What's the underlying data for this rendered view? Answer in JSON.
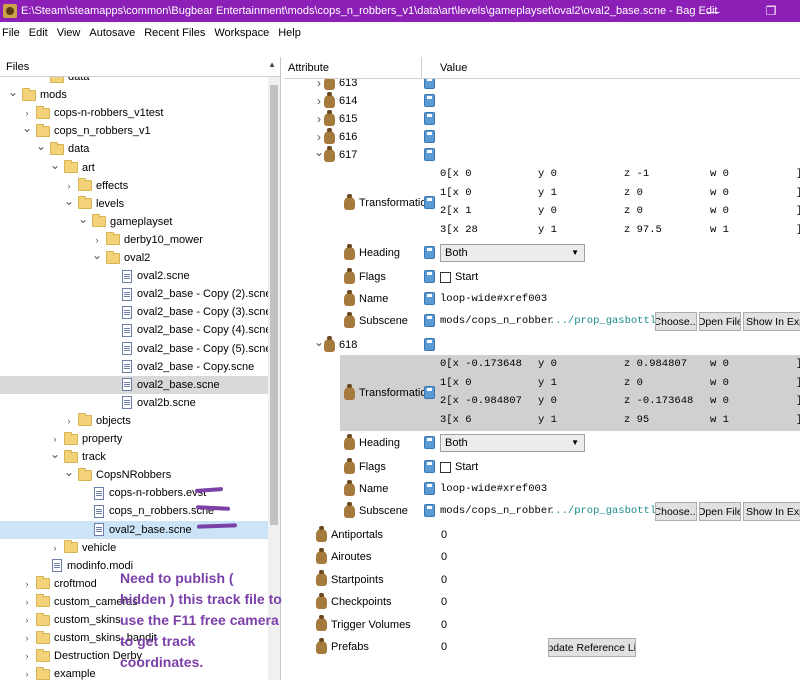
{
  "window": {
    "title": "E:\\Steam\\steamapps\\common\\Bugbear Entertainment\\mods\\cops_n_robbers_v1\\data\\art\\levels\\gameplayset\\oval2\\oval2_base.scne - Bag Edit",
    "minimize": "—",
    "maximize": "❐"
  },
  "menu": [
    "File",
    "Edit",
    "View",
    "Autosave",
    "Recent Files",
    "Workspace",
    "Help"
  ],
  "files_panel": {
    "header": "Files",
    "tree": [
      {
        "label": "data",
        "level": 2,
        "type": "folder",
        "arrow": "",
        "partial": true
      },
      {
        "label": "mods",
        "level": 0,
        "type": "folder",
        "arrow": "⌄"
      },
      {
        "label": "cops-n-robbers_v1test",
        "level": 1,
        "type": "folder",
        "arrow": "›"
      },
      {
        "label": "cops_n_robbers_v1",
        "level": 1,
        "type": "folder",
        "arrow": "⌄"
      },
      {
        "label": "data",
        "level": 2,
        "type": "folder",
        "arrow": "⌄"
      },
      {
        "label": "art",
        "level": 3,
        "type": "folder",
        "arrow": "⌄"
      },
      {
        "label": "effects",
        "level": 4,
        "type": "folder",
        "arrow": "›"
      },
      {
        "label": "levels",
        "level": 4,
        "type": "folder",
        "arrow": "⌄"
      },
      {
        "label": "gameplayset",
        "level": 5,
        "type": "folder",
        "arrow": "⌄"
      },
      {
        "label": "derby10_mower",
        "level": 6,
        "type": "folder",
        "arrow": "›"
      },
      {
        "label": "oval2",
        "level": 6,
        "type": "folder",
        "arrow": "⌄"
      },
      {
        "label": "oval2.scne",
        "level": 7,
        "type": "file",
        "arrow": ""
      },
      {
        "label": "oval2_base - Copy (2).scne",
        "level": 7,
        "type": "file",
        "arrow": ""
      },
      {
        "label": "oval2_base - Copy (3).scne",
        "level": 7,
        "type": "file",
        "arrow": ""
      },
      {
        "label": "oval2_base - Copy (4).scne",
        "level": 7,
        "type": "file",
        "arrow": ""
      },
      {
        "label": "oval2_base - Copy (5).scne",
        "level": 7,
        "type": "file",
        "arrow": ""
      },
      {
        "label": "oval2_base - Copy.scne",
        "level": 7,
        "type": "file",
        "arrow": ""
      },
      {
        "label": "oval2_base.scne",
        "level": 7,
        "type": "file",
        "arrow": "",
        "selected": true
      },
      {
        "label": "oval2b.scne",
        "level": 7,
        "type": "file",
        "arrow": ""
      },
      {
        "label": "objects",
        "level": 4,
        "type": "folder",
        "arrow": "›"
      },
      {
        "label": "property",
        "level": 3,
        "type": "folder",
        "arrow": "›"
      },
      {
        "label": "track",
        "level": 3,
        "type": "folder",
        "arrow": "⌄"
      },
      {
        "label": "CopsNRobbers",
        "level": 4,
        "type": "folder",
        "arrow": "⌄"
      },
      {
        "label": "cops-n-robbers.evst",
        "level": 5,
        "type": "file",
        "arrow": ""
      },
      {
        "label": "cops_n_robbers.scne",
        "level": 5,
        "type": "file",
        "arrow": ""
      },
      {
        "label": "oval2_base.scne",
        "level": 5,
        "type": "file",
        "arrow": "",
        "highlight": true
      },
      {
        "label": "vehicle",
        "level": 3,
        "type": "folder",
        "arrow": "›"
      },
      {
        "label": "modinfo.modi",
        "level": 2,
        "type": "file",
        "arrow": ""
      },
      {
        "label": "croftmod",
        "level": 1,
        "type": "folder",
        "arrow": "›"
      },
      {
        "label": "custom_cameras",
        "level": 1,
        "type": "folder",
        "arrow": "›"
      },
      {
        "label": "custom_skins",
        "level": 1,
        "type": "folder",
        "arrow": "›"
      },
      {
        "label": "custom_skins_bandit",
        "level": 1,
        "type": "folder",
        "arrow": "›"
      },
      {
        "label": "Destruction Derby",
        "level": 1,
        "type": "folder",
        "arrow": "›"
      },
      {
        "label": "example",
        "level": 1,
        "type": "folder",
        "arrow": "›"
      },
      {
        "label": "",
        "level": 1,
        "type": "folder",
        "arrow": "›",
        "partial": true
      }
    ],
    "annotation": "Need to publish ( hidden ) this track file to use the F11 free camera to get track coordinates."
  },
  "attr_panel": {
    "col_attribute": "Attribute",
    "col_value": "Value",
    "collapsed_nodes": [
      "613",
      "614",
      "615",
      "616"
    ],
    "nodes": [
      {
        "id": "617",
        "matrix": [
          [
            "0[x 0",
            "y 0",
            "z -1",
            "w 0",
            "]"
          ],
          [
            "1[x 0",
            "y 1",
            "z 0",
            "w 0",
            "]"
          ],
          [
            "2[x 1",
            "y 0",
            "z 0",
            "w 0",
            "]"
          ],
          [
            "3[x 28",
            "y 1",
            "z 97.5",
            "w 1",
            "]"
          ]
        ],
        "heading": "Both",
        "flags": "Start",
        "name": "loop-wide#xref003",
        "subscene_path": "mods/cops_n_robber",
        "subscene_tail": ".../prop_gasbottle"
      },
      {
        "id": "618",
        "matrix": [
          [
            "0[x -0.173648",
            "y 0",
            "z 0.984807",
            "w 0",
            "]"
          ],
          [
            "1[x 0",
            "y 1",
            "z 0",
            "w 0",
            "]"
          ],
          [
            "2[x -0.984807",
            "y 0",
            "z -0.173648",
            "w 0",
            "]"
          ],
          [
            "3[x 6",
            "y 1",
            "z 95",
            "w 1",
            "]"
          ]
        ],
        "heading": "Both",
        "flags": "Start",
        "name": "loop-wide#xref003",
        "subscene_path": "mods/cops_n_robber",
        "subscene_tail": ".../prop_gasbottle"
      }
    ],
    "labels": {
      "transformation": "Transformation",
      "heading": "Heading",
      "flags": "Flags",
      "name": "Name",
      "subscene": "Subscene",
      "choose": "Choose...",
      "open_file": "Open File",
      "show_in_explorer": "Show In Explorer"
    },
    "bottom_attrs": [
      {
        "label": "Antiportals",
        "value": "0"
      },
      {
        "label": "Airoutes",
        "value": "0"
      },
      {
        "label": "Startpoints",
        "value": "0"
      },
      {
        "label": "Checkpoints",
        "value": "0"
      },
      {
        "label": "Trigger Volumes",
        "value": "0"
      },
      {
        "label": "Prefabs",
        "value": "0"
      }
    ],
    "update_button": "Update Reference List"
  },
  "colors": {
    "titlebar": "#8b1fb6",
    "annotation": "#7b3fa8",
    "subscene_tail": "#1c8a8a"
  }
}
